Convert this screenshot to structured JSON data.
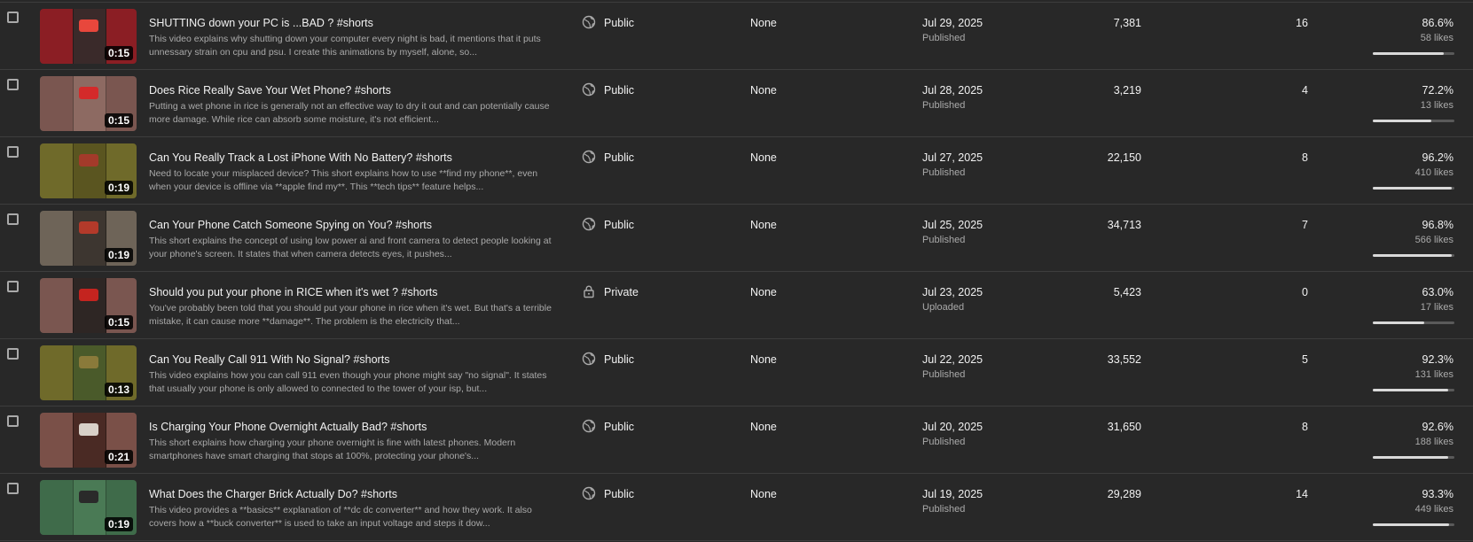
{
  "colors": {
    "background": "#282828",
    "divider": "#3d3d3d",
    "primary_text": "#f1f1f1",
    "secondary_text": "#aaaaaa"
  },
  "videos": [
    {
      "title": "SHUTTING down your PC is ...BAD ? #shorts",
      "description": "This video explains why shutting down your computer every night is bad, it mentions that it puts unnessary strain on cpu and psu. I create this animations by myself, alone, so...",
      "duration": "0:15",
      "thumb_bg": "#8b1e24",
      "thumb_inner": "#3a2a2a",
      "thumb_mark": "#e8473c",
      "visibility": "Public",
      "visibility_icon": "globe-icon",
      "restrictions": "None",
      "date": "Jul 29, 2025",
      "date_status": "Published",
      "views": "7,381",
      "comments": "16",
      "likes_pct": "86.6%",
      "likes_count": "58 likes",
      "likes_ratio": 0.866
    },
    {
      "title": "Does Rice Really Save Your Wet Phone? #shorts",
      "description": "Putting a wet phone in rice is generally not an effective way to dry it out and can potentially cause more damage. While rice can absorb some moisture, it's not efficient...",
      "duration": "0:15",
      "thumb_bg": "#7a5650",
      "thumb_inner": "#8d6a62",
      "thumb_mark": "#d42a2a",
      "visibility": "Public",
      "visibility_icon": "globe-icon",
      "restrictions": "None",
      "date": "Jul 28, 2025",
      "date_status": "Published",
      "views": "3,219",
      "comments": "4",
      "likes_pct": "72.2%",
      "likes_count": "13 likes",
      "likes_ratio": 0.722
    },
    {
      "title": "Can You Really Track a Lost iPhone With No Battery? #shorts",
      "description": "Need to locate your misplaced device? This short explains how to use **find my phone**, even when your device is offline via **apple find my**. This **tech tips** feature helps...",
      "duration": "0:19",
      "thumb_bg": "#6f6a2a",
      "thumb_inner": "#5a5520",
      "thumb_mark": "#a33a2a",
      "visibility": "Public",
      "visibility_icon": "globe-icon",
      "restrictions": "None",
      "date": "Jul 27, 2025",
      "date_status": "Published",
      "views": "22,150",
      "comments": "8",
      "likes_pct": "96.2%",
      "likes_count": "410 likes",
      "likes_ratio": 0.962
    },
    {
      "title": "Can Your Phone Catch Someone Spying on You? #shorts",
      "description": "This short explains the concept of using low power ai and front camera to detect people looking at your phone's screen. It states that when camera detects eyes, it pushes...",
      "duration": "0:19",
      "thumb_bg": "#6e6458",
      "thumb_inner": "#3d3630",
      "thumb_mark": "#b33a2a",
      "visibility": "Public",
      "visibility_icon": "globe-icon",
      "restrictions": "None",
      "date": "Jul 25, 2025",
      "date_status": "Published",
      "views": "34,713",
      "comments": "7",
      "likes_pct": "96.8%",
      "likes_count": "566 likes",
      "likes_ratio": 0.968
    },
    {
      "title": "Should you put your phone in RICE when it's wet ? #shorts",
      "description": "You've probably been told that you should put your phone in rice when it's wet. But that's a terrible mistake, it can cause more **damage**. The problem is the electricity that...",
      "duration": "0:15",
      "thumb_bg": "#7a5650",
      "thumb_inner": "#2e2624",
      "thumb_mark": "#c4241f",
      "visibility": "Private",
      "visibility_icon": "lock-icon",
      "restrictions": "None",
      "date": "Jul 23, 2025",
      "date_status": "Uploaded",
      "views": "5,423",
      "comments": "0",
      "likes_pct": "63.0%",
      "likes_count": "17 likes",
      "likes_ratio": 0.63
    },
    {
      "title": "Can You Really Call 911 With No Signal? #shorts",
      "description": "This video explains how you can call 911 even though your phone might say \"no signal\". It states that usually your phone is only allowed to connected to the tower of your isp, but...",
      "duration": "0:13",
      "thumb_bg": "#6f6a2a",
      "thumb_inner": "#4a5a2a",
      "thumb_mark": "#8a7a3a",
      "visibility": "Public",
      "visibility_icon": "globe-icon",
      "restrictions": "None",
      "date": "Jul 22, 2025",
      "date_status": "Published",
      "views": "33,552",
      "comments": "5",
      "likes_pct": "92.3%",
      "likes_count": "131 likes",
      "likes_ratio": 0.923
    },
    {
      "title": "Is Charging Your Phone Overnight Actually Bad? #shorts",
      "description": "This short explains how charging your phone overnight is fine with latest phones. Modern smartphones have smart charging that stops at 100%, protecting your phone's...",
      "duration": "0:21",
      "thumb_bg": "#7a5048",
      "thumb_inner": "#4a2a24",
      "thumb_mark": "#d8d0c8",
      "visibility": "Public",
      "visibility_icon": "globe-icon",
      "restrictions": "None",
      "date": "Jul 20, 2025",
      "date_status": "Published",
      "views": "31,650",
      "comments": "8",
      "likes_pct": "92.6%",
      "likes_count": "188 likes",
      "likes_ratio": 0.926
    },
    {
      "title": "What Does the Charger Brick Actually Do? #shorts",
      "description": "This video provides a **basics** explanation of **dc dc converter** and how they work. It also covers how a **buck converter** is used to take an input voltage and steps it dow...",
      "duration": "0:19",
      "thumb_bg": "#3f6b4a",
      "thumb_inner": "#4a7a55",
      "thumb_mark": "#2a2a2a",
      "visibility": "Public",
      "visibility_icon": "globe-icon",
      "restrictions": "None",
      "date": "Jul 19, 2025",
      "date_status": "Published",
      "views": "29,289",
      "comments": "14",
      "likes_pct": "93.3%",
      "likes_count": "449 likes",
      "likes_ratio": 0.933
    }
  ]
}
